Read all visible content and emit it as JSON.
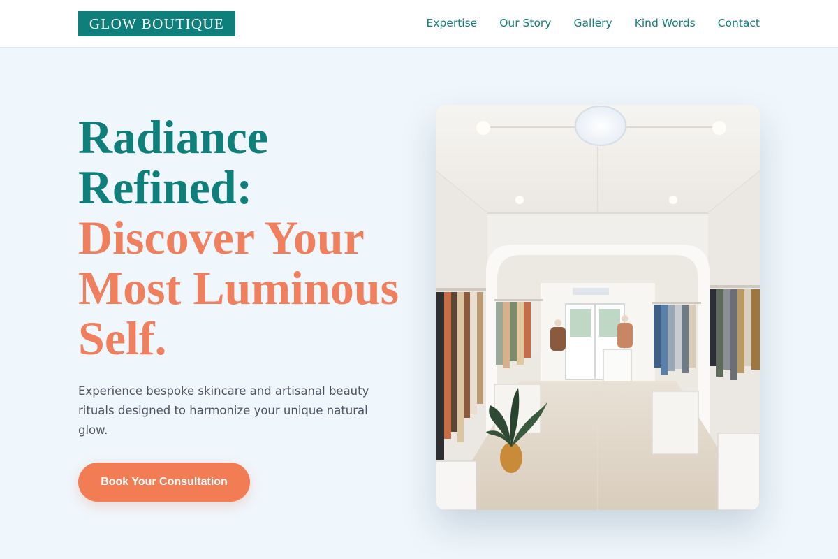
{
  "header": {
    "logo": "GLOW BOUTIQUE",
    "nav": [
      {
        "label": "Expertise"
      },
      {
        "label": "Our Story"
      },
      {
        "label": "Gallery"
      },
      {
        "label": "Kind Words"
      },
      {
        "label": "Contact"
      }
    ]
  },
  "hero": {
    "headline_line1": "Radiance",
    "headline_line2": "Refined:",
    "headline_line3": "Discover Your",
    "headline_line4": "Most Luminous",
    "headline_line5": "Self.",
    "description": "Experience bespoke skincare and artisanal beauty rituals designed to harmonize your unique natural glow.",
    "cta_label": "Book Your Consultation"
  },
  "colors": {
    "brand_teal": "#0e7f7a",
    "accent_coral": "#f27c54",
    "page_background": "#eff6fc"
  }
}
